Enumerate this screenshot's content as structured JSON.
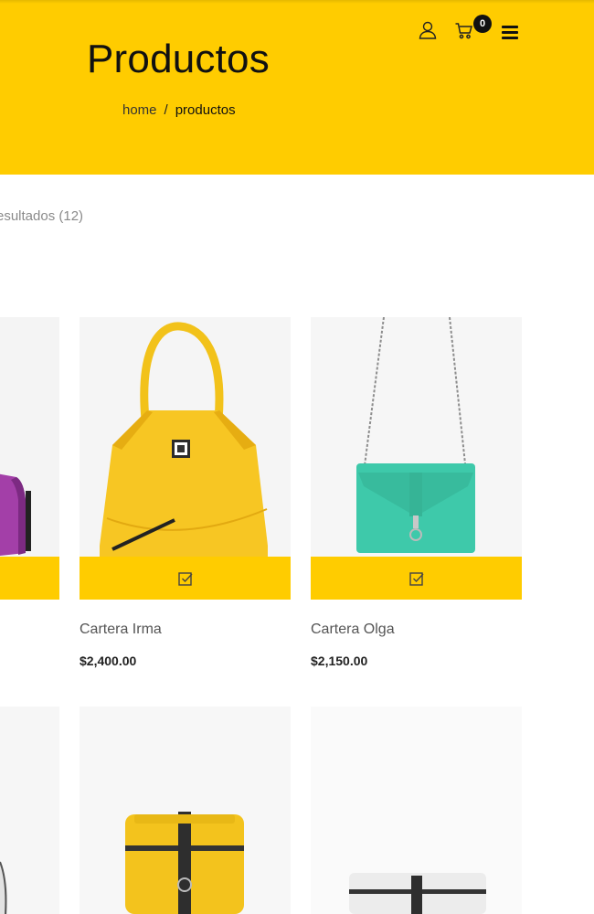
{
  "header": {
    "title": "Productos",
    "breadcrumb": {
      "home": "home",
      "separator": "/",
      "current": "productos"
    },
    "cart_count": "0",
    "icons": [
      "user-icon",
      "cart-icon",
      "menu-icon"
    ],
    "bg_color": "#ffcc00"
  },
  "results": {
    "label": "esultados (12)"
  },
  "products": [
    {
      "name": "Cartera Irma",
      "price": "$2,400.00",
      "color": "yellow"
    },
    {
      "name": "Cartera Olga",
      "price": "$2,150.00",
      "color": "turquoise"
    }
  ],
  "colors": {
    "accent": "#ffcc00",
    "text": "#222222",
    "muted": "#8a8a8a"
  }
}
